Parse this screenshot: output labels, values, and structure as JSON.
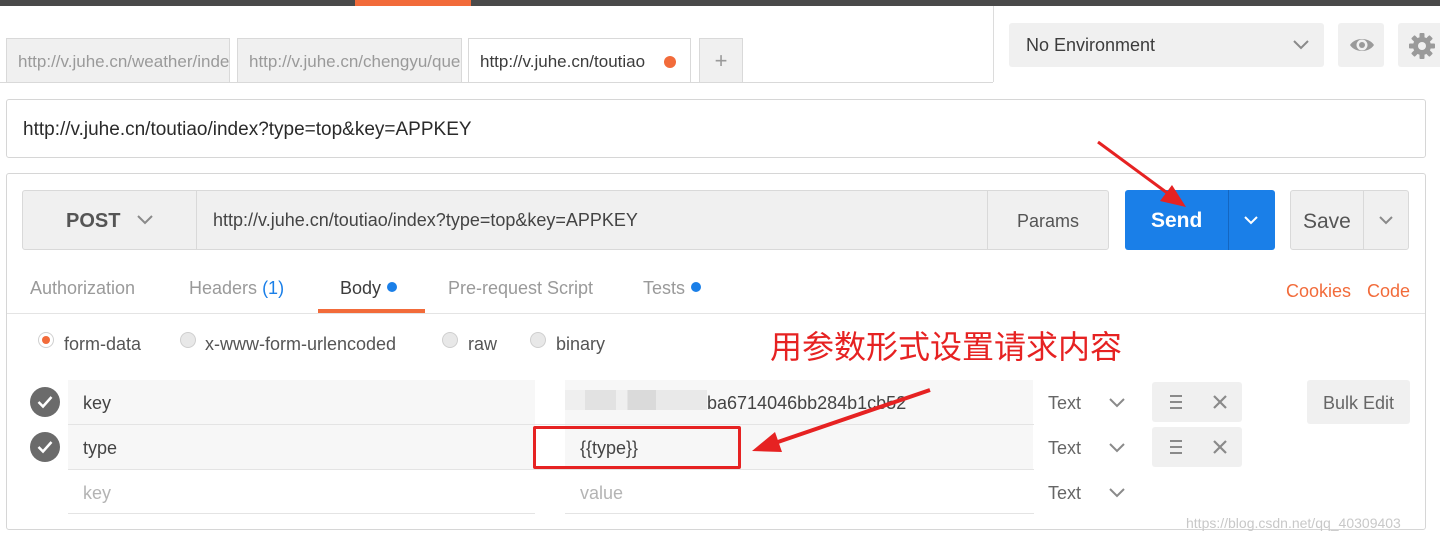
{
  "tabs": [
    {
      "label": "http://v.juhe.cn/weather/index",
      "active": false
    },
    {
      "label": "http://v.juhe.cn/chengyu/query",
      "active": false
    },
    {
      "label": "http://v.juhe.cn/toutiao",
      "active": true,
      "unsaved": true
    }
  ],
  "add_tab_label": "+",
  "environment": {
    "selected": "No Environment"
  },
  "request_name": "http://v.juhe.cn/toutiao/index?type=top&key=APPKEY",
  "request": {
    "method": "POST",
    "url": "http://v.juhe.cn/toutiao/index?type=top&key=APPKEY",
    "params_label": "Params",
    "send_label": "Send",
    "save_label": "Save"
  },
  "subtabs": {
    "authorization": "Authorization",
    "headers": "Headers",
    "headers_count": "(1)",
    "body": "Body",
    "prerequest": "Pre-request Script",
    "tests": "Tests",
    "cookies": "Cookies",
    "code": "Code"
  },
  "body_types": {
    "form_data": "form-data",
    "urlencoded": "x-www-form-urlencoded",
    "raw": "raw",
    "binary": "binary",
    "selected": "form-data"
  },
  "annotation": "用参数形式设置请求内容",
  "form_rows": [
    {
      "key": "key",
      "value": "ba6714046bb284b1cb52",
      "type": "Text",
      "checked": true
    },
    {
      "key": "type",
      "value": "{{type}}",
      "type": "Text",
      "checked": true
    }
  ],
  "new_row": {
    "key_placeholder": "key",
    "value_placeholder": "value",
    "type": "Text"
  },
  "bulk_edit_label": "Bulk Edit",
  "watermark": "https://blog.csdn.net/qq_40309403",
  "colors": {
    "accent": "#f26b3a",
    "primary": "#1a7fe8",
    "annotation": "#e62222"
  }
}
